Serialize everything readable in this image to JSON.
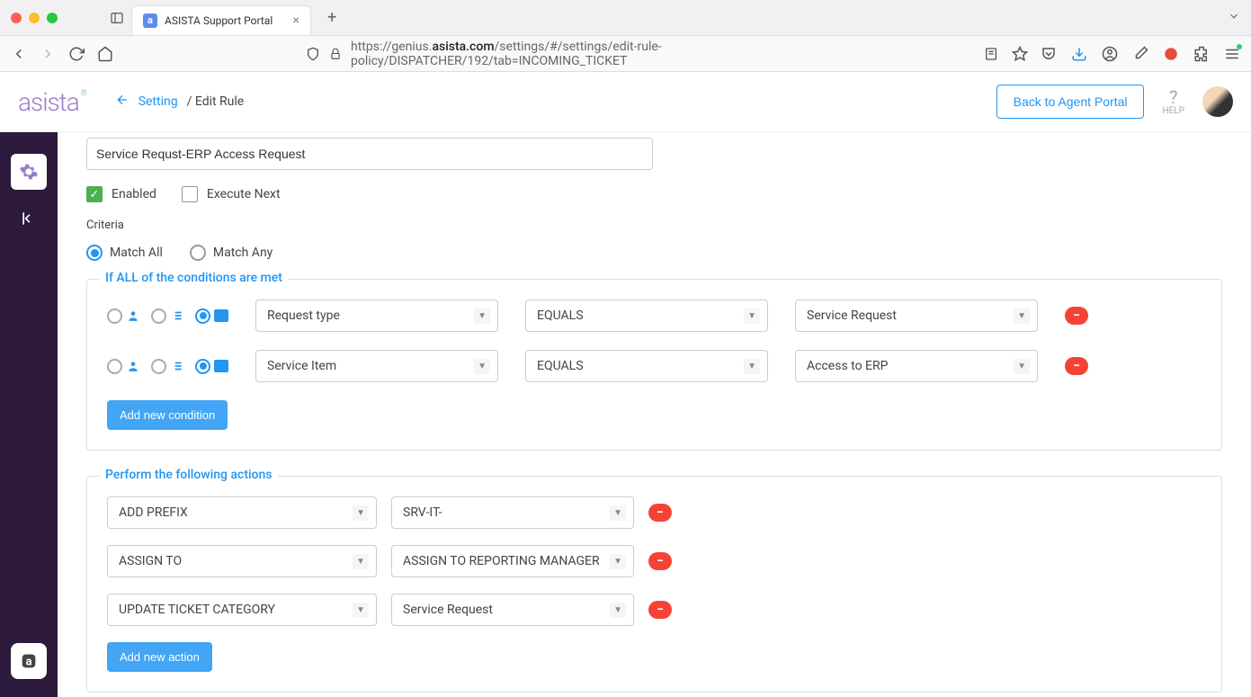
{
  "browser": {
    "tab_title": "ASISTA Support Portal",
    "url_prefix": "https://genius.",
    "url_domain": "asista.com",
    "url_path": "/settings/#/settings/edit-rule-policy/DISPATCHER/192/tab=INCOMING_TICKET"
  },
  "header": {
    "logo": "asista",
    "breadcrumb_setting": "Setting",
    "breadcrumb_current": "/ Edit Rule",
    "agent_portal_btn": "Back to Agent Portal",
    "help_label": "HELP"
  },
  "form": {
    "rule_name": "Service Requst-ERP Access Request",
    "enabled_label": "Enabled",
    "execute_next_label": "Execute Next",
    "criteria_label": "Criteria",
    "match_all_label": "Match All",
    "match_any_label": "Match Any"
  },
  "conditions_section": {
    "legend": "If ALL of the conditions are met",
    "rows": [
      {
        "field": "Request type",
        "operator": "EQUALS",
        "value": "Service Request"
      },
      {
        "field": "Service Item",
        "operator": "EQUALS",
        "value": "Access to ERP"
      }
    ],
    "add_btn": "Add new condition"
  },
  "actions_section": {
    "legend": "Perform the following actions",
    "rows": [
      {
        "action": "ADD PREFIX",
        "value": "SRV-IT-"
      },
      {
        "action": "ASSIGN TO",
        "value": "ASSIGN TO REPORTING MANAGER"
      },
      {
        "action": "UPDATE TICKET CATEGORY",
        "value": "Service Request"
      }
    ],
    "add_btn": "Add new action"
  }
}
